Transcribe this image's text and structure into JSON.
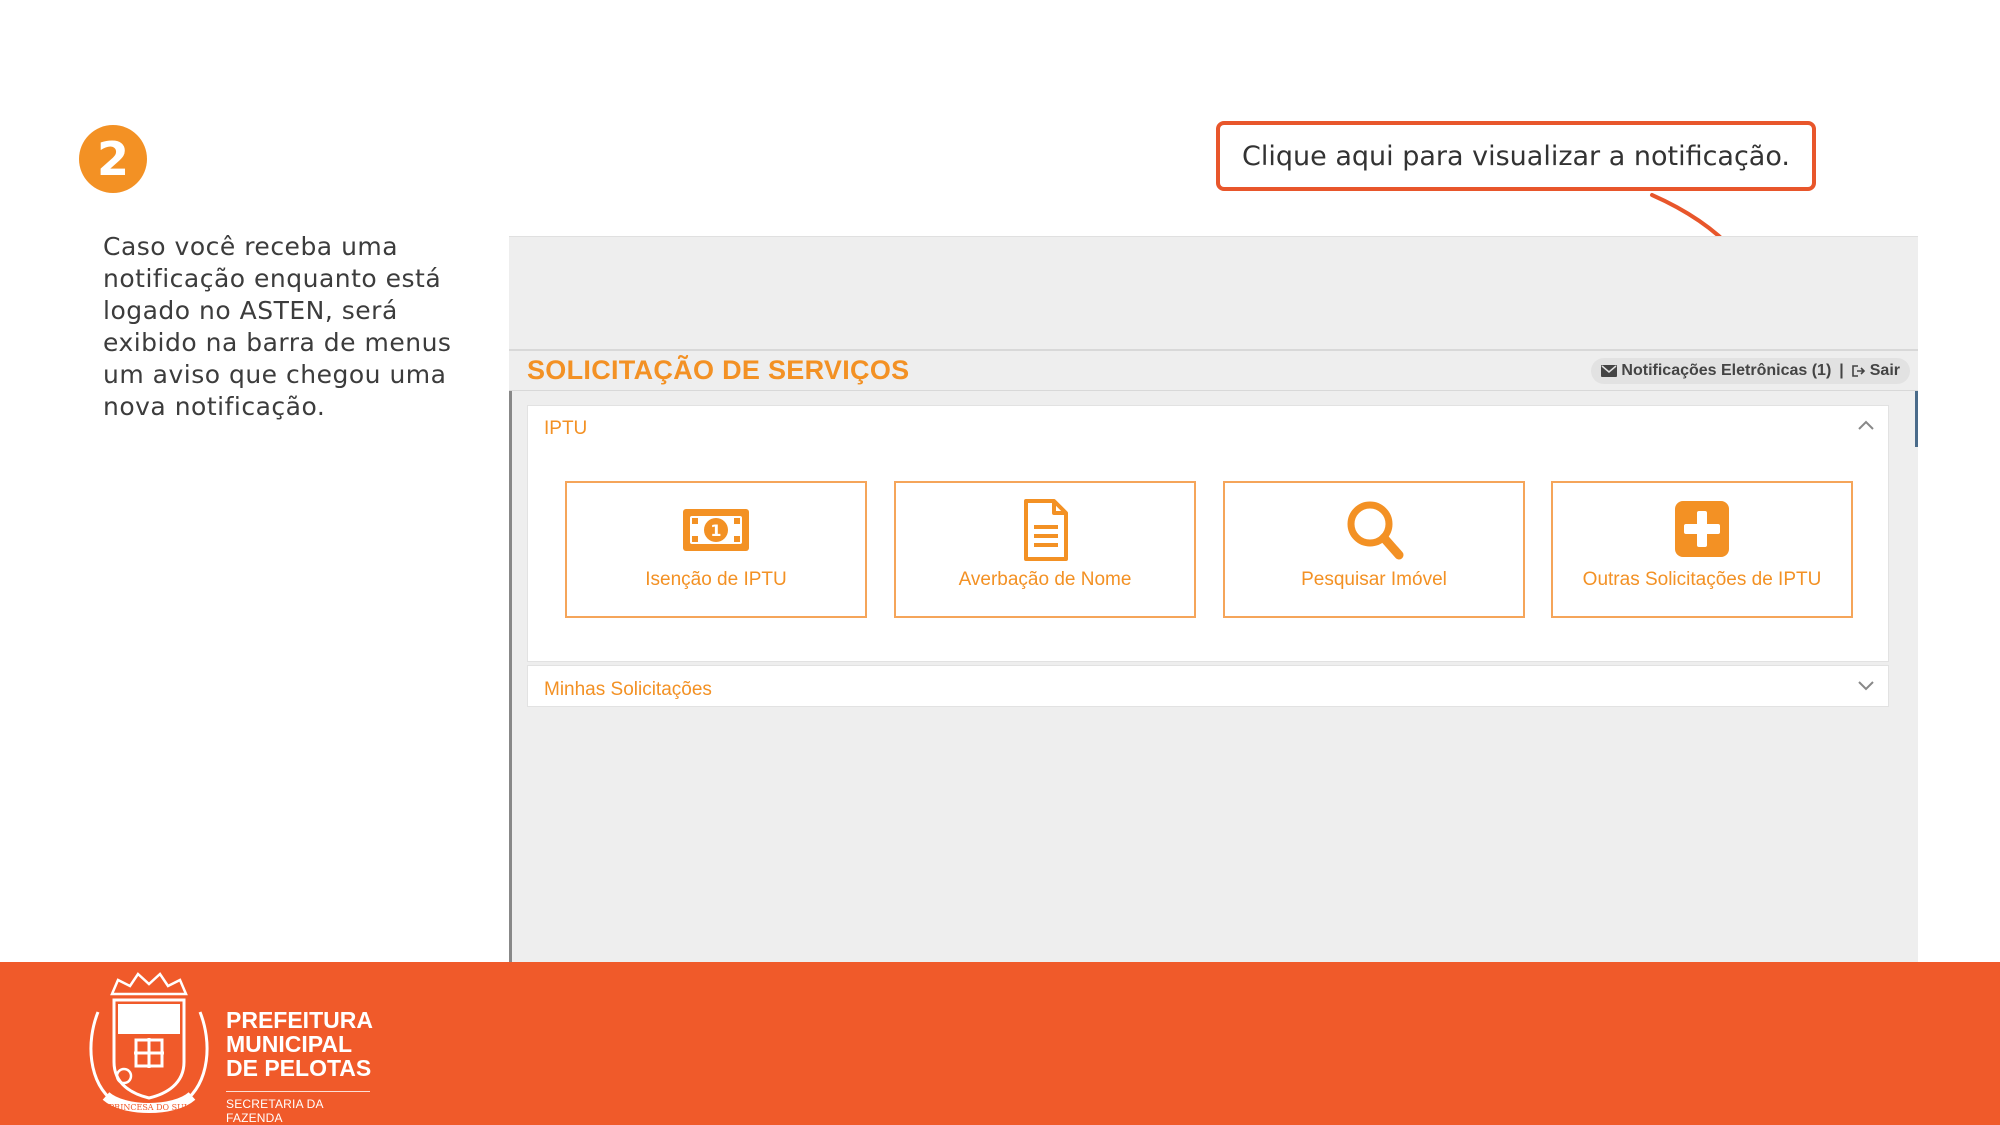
{
  "step": {
    "number": "2"
  },
  "description": "Caso você receba uma notificação enquanto está logado no ASTEN, será exibido na barra de menus um aviso que chegou uma nova notificação.",
  "callout": {
    "text": "Clique aqui para visualizar a notificação."
  },
  "app": {
    "title": "SOLICITAÇÃO DE SERVIÇOS",
    "user_menu": {
      "notifications_label": "Notificações Eletrônicas (1)",
      "separator": "|",
      "logout_label": "Sair"
    },
    "panels": [
      {
        "heading": "IPTU",
        "expanded": true,
        "tiles": [
          {
            "label": "Isenção de IPTU",
            "icon": "money-bill-icon"
          },
          {
            "label": "Averbação de Nome",
            "icon": "document-icon"
          },
          {
            "label": "Pesquisar Imóvel",
            "icon": "search-icon"
          },
          {
            "label": "Outras Solicitações de IPTU",
            "icon": "plus-square-icon"
          }
        ]
      },
      {
        "heading": "Minhas Solicitações",
        "expanded": false
      }
    ]
  },
  "footer": {
    "org_lines": [
      "PREFEITURA",
      "MUNICIPAL",
      "DE PELOTAS"
    ],
    "department": "SECRETARIA DA FAZENDA",
    "crest_motto": "PRINCESA DO SUL"
  },
  "colors": {
    "accent_orange": "#f39124",
    "callout_red": "#e8562b",
    "footer_orange": "#f05a2a"
  }
}
